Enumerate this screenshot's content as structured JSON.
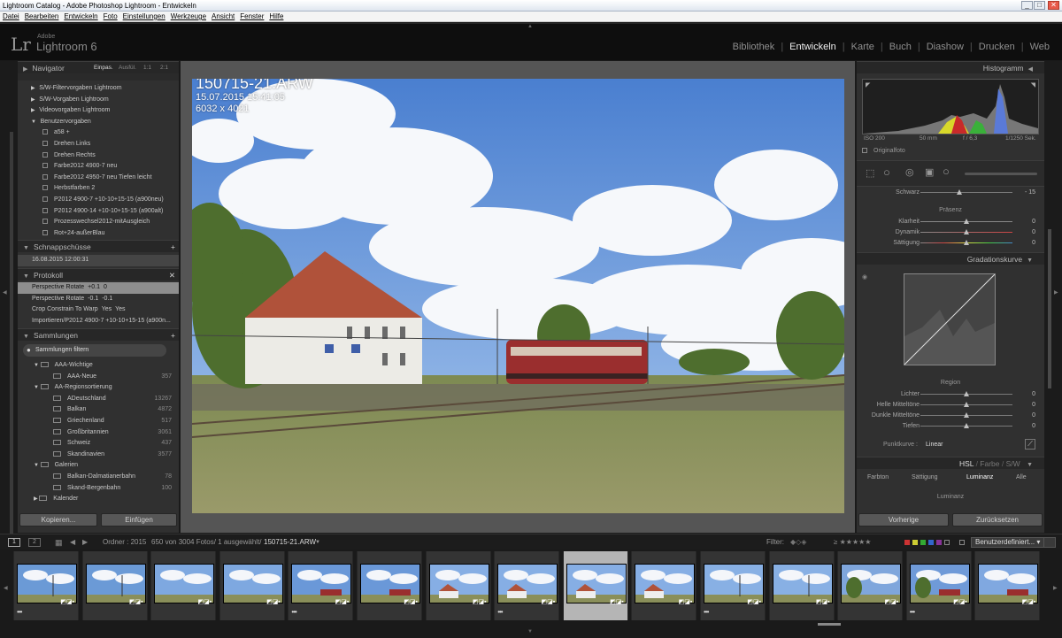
{
  "window": {
    "title": "Lightroom Catalog - Adobe Photoshop Lightroom - Entwickeln",
    "minimize": "_",
    "maximize": "□",
    "close": "✕"
  },
  "menu": [
    "Datei",
    "Bearbeiten",
    "Entwickeln",
    "Foto",
    "Einstellungen",
    "Werkzeuge",
    "Ansicht",
    "Fenster",
    "Hilfe"
  ],
  "identity": {
    "logo": "Lr",
    "adobe": "Adobe",
    "product": "Lightroom 6"
  },
  "modules": [
    "Bibliothek",
    "Entwickeln",
    "Karte",
    "Buch",
    "Diashow",
    "Drucken",
    "Web"
  ],
  "active_module": "Entwickeln",
  "left": {
    "navigator": {
      "title": "Navigator",
      "zoom_options": [
        "Einpas.",
        "Ausfül.",
        "1:1",
        "2:1"
      ]
    },
    "presets": [
      {
        "label": "S/W-Filtervorgaben Lightroom",
        "type": "folder"
      },
      {
        "label": "S/W-Vorgaben Lightroom",
        "type": "folder"
      },
      {
        "label": "Videovorgaben Lightroom",
        "type": "folder"
      },
      {
        "label": "Benutzervorgaben",
        "type": "folder-open"
      },
      {
        "label": "a58 +",
        "type": "preset"
      },
      {
        "label": "Drehen Links",
        "type": "preset"
      },
      {
        "label": "Drehen Rechts",
        "type": "preset"
      },
      {
        "label": "Farbe2012 4900-7 neu",
        "type": "preset"
      },
      {
        "label": "Farbe2012 4950-7 neu Tiefen leicht",
        "type": "preset"
      },
      {
        "label": "Herbstfarben 2",
        "type": "preset"
      },
      {
        "label": "P2012 4900-7 +10-10+15-15 (a900neu)",
        "type": "preset"
      },
      {
        "label": "P2012 4900-14 +10-10+15-15 (a900alt)",
        "type": "preset"
      },
      {
        "label": "Prozesswechsel2012-mitAusgleich",
        "type": "preset"
      },
      {
        "label": "Rot+24-außerBlau",
        "type": "preset"
      }
    ],
    "snapshots": {
      "title": "Schnappschüsse",
      "add": "+",
      "items": [
        "16.08.2015 12:00:31"
      ]
    },
    "history": {
      "title": "Protokoll",
      "clear": "✕",
      "items": [
        {
          "label": "Perspective Rotate",
          "a": "+0.1",
          "b": "0"
        },
        {
          "label": "Perspective Rotate",
          "a": "-0.1",
          "b": "-0.1"
        },
        {
          "label": "Crop Constrain To Warp",
          "a": "Yes",
          "b": "Yes"
        },
        {
          "label": "Importieren/P2012 4900-7 +10-10+15-15 (a900n...",
          "a": "",
          "b": ""
        }
      ]
    },
    "collections": {
      "title": "Sammlungen",
      "add": "+",
      "filter": "Sammlungen filtern",
      "items": [
        {
          "label": "AAA-Wichtige",
          "count": "",
          "level": 1,
          "type": "set"
        },
        {
          "label": "AAA-Neue",
          "count": "357",
          "level": 2,
          "type": "coll"
        },
        {
          "label": "AA-Regionsortierung",
          "count": "",
          "level": 1,
          "type": "set"
        },
        {
          "label": "ADeutschland",
          "count": "13267",
          "level": 2,
          "type": "coll"
        },
        {
          "label": "Balkan",
          "count": "4872",
          "level": 2,
          "type": "coll"
        },
        {
          "label": "Griechenland",
          "count": "517",
          "level": 2,
          "type": "coll"
        },
        {
          "label": "Großbritannien",
          "count": "3061",
          "level": 2,
          "type": "coll"
        },
        {
          "label": "Schweiz",
          "count": "437",
          "level": 2,
          "type": "coll"
        },
        {
          "label": "Skandinavien",
          "count": "3577",
          "level": 2,
          "type": "coll"
        },
        {
          "label": "Galerien",
          "count": "",
          "level": 1,
          "type": "set"
        },
        {
          "label": "Balkan-Dalmatianerbahn",
          "count": "78",
          "level": 2,
          "type": "coll"
        },
        {
          "label": "Skand-Bergenbahn",
          "count": "100",
          "level": 2,
          "type": "coll"
        },
        {
          "label": "Kalender",
          "count": "",
          "level": 1,
          "type": "set-closed"
        }
      ]
    },
    "copy_button": "Kopieren...",
    "paste_button": "Einfügen"
  },
  "photo": {
    "filename": "150715-21.ARW",
    "datetime": "15.07.2015 15:41:05",
    "dimensions": "6032 x 4021"
  },
  "right": {
    "histogram": {
      "title": "Histogramm",
      "iso": "ISO 200",
      "focal": "50 mm",
      "aperture": "f / 6,3",
      "shutter": "1/1250 Sek.",
      "original_label": "Originalfoto"
    },
    "black": {
      "label": "Schwarz",
      "value": "- 15"
    },
    "presence": {
      "title": "Präsenz",
      "sliders": [
        {
          "label": "Klarheit",
          "value": "0"
        },
        {
          "label": "Dynamik",
          "value": "0"
        },
        {
          "label": "Sättigung",
          "value": "0"
        }
      ]
    },
    "tone_curve": {
      "title": "Gradationskurve",
      "region_title": "Region",
      "sliders": [
        {
          "label": "Lichter",
          "value": "0"
        },
        {
          "label": "Helle Mitteltöne",
          "value": "0"
        },
        {
          "label": "Dunkle Mitteltöne",
          "value": "0"
        },
        {
          "label": "Tiefen",
          "value": "0"
        }
      ],
      "point_curve_label": "Punktkurve :",
      "point_curve_value": "Linear"
    },
    "hsl": {
      "tabs": [
        "HSL",
        "Farbe",
        "S/W"
      ],
      "sub_tabs": [
        "Farbton",
        "Sättigung",
        "Luminanz",
        "Alle"
      ],
      "active_sub": "Luminanz",
      "section": "Luminanz"
    },
    "prev_button": "Vorherige",
    "reset_button": "Zurücksetzen"
  },
  "filmstrip_bar": {
    "view1": "1",
    "view2": "2",
    "source": "Ordner : 2015",
    "count": "650 von 3004 Fotos/ 1 ausgewählt/",
    "current": "150715-21.ARW",
    "filter_label": "Filter:",
    "custom_filter": "Benutzerdefiniert..."
  },
  "thumbnails": [
    {
      "dots": "•••",
      "selected": false,
      "scene": "station-pole"
    },
    {
      "dots": "",
      "selected": false,
      "scene": "station-pole"
    },
    {
      "dots": "",
      "selected": false,
      "scene": "sky"
    },
    {
      "dots": "",
      "selected": false,
      "scene": "sky"
    },
    {
      "dots": "•••",
      "selected": false,
      "scene": "train"
    },
    {
      "dots": "",
      "selected": false,
      "scene": "train"
    },
    {
      "dots": "",
      "selected": false,
      "scene": "building"
    },
    {
      "dots": "•••",
      "selected": false,
      "scene": "building"
    },
    {
      "dots": "",
      "selected": true,
      "scene": "building"
    },
    {
      "dots": "",
      "selected": false,
      "scene": "building"
    },
    {
      "dots": "•••",
      "selected": false,
      "scene": "pole-field"
    },
    {
      "dots": "",
      "selected": false,
      "scene": "pole-field"
    },
    {
      "dots": "",
      "selected": false,
      "scene": "tree"
    },
    {
      "dots": "•••",
      "selected": false,
      "scene": "tree-train"
    },
    {
      "dots": "",
      "selected": false,
      "scene": "train-field"
    }
  ],
  "colors": {
    "accent_red": "#c23a3a",
    "panel": "#303030",
    "selected_row": "#8e8e8e"
  }
}
